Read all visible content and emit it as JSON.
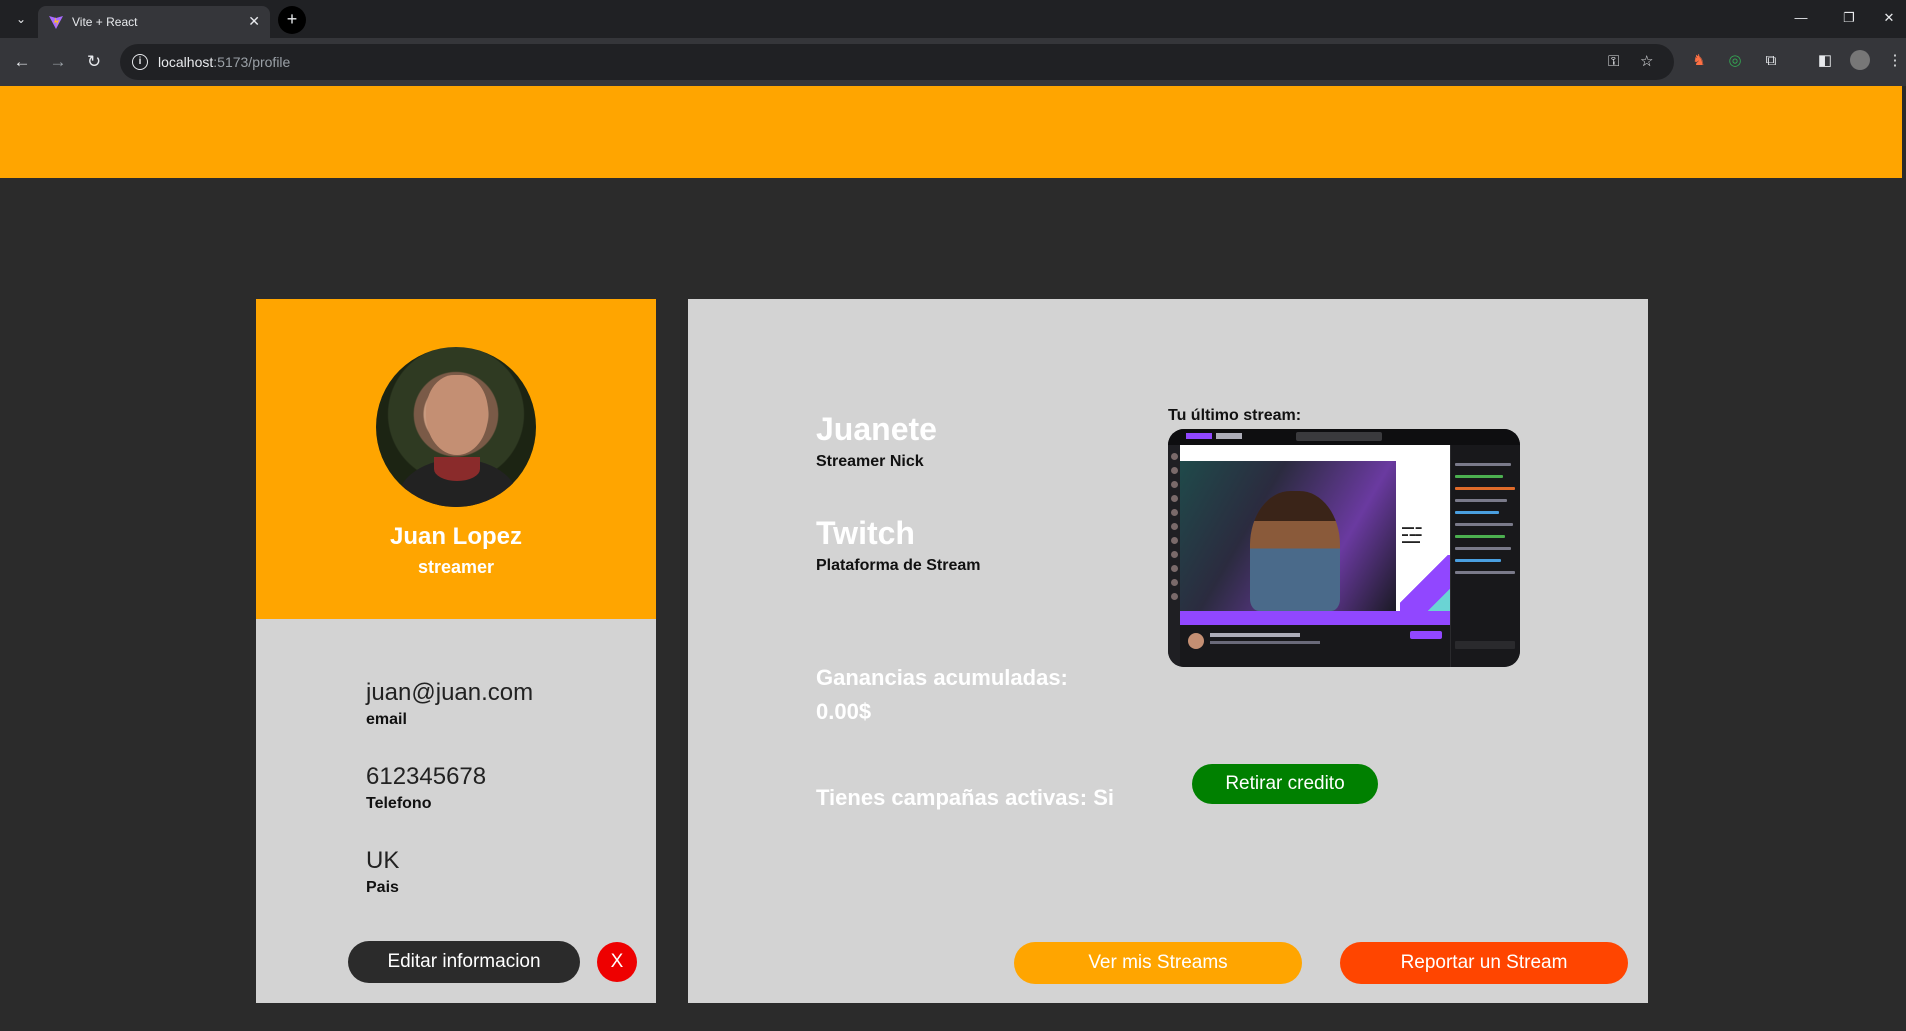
{
  "browser": {
    "tab_title": "Vite + React",
    "tab_close": "✕",
    "new_tab": "+",
    "url_host": "localhost",
    "url_rest": ":5173/profile"
  },
  "profile": {
    "name": "Juan Lopez",
    "role": "streamer",
    "email_value": "juan@juan.com",
    "email_label": "email",
    "phone_value": "612345678",
    "phone_label": "Telefono",
    "country_value": "UK",
    "country_label": "Pais",
    "edit_button": "Editar informacion",
    "close_button": "X"
  },
  "main": {
    "nick_value": "Juanete",
    "nick_label": "Streamer Nick",
    "platform_value": "Twitch",
    "platform_label": "Plataforma de Stream",
    "last_stream_label": "Tu último stream:",
    "earnings_label": "Ganancias acumuladas:",
    "earnings_value": "0.00$",
    "withdraw_button": "Retirar credito",
    "campaigns_text": "Tienes campañas activas: Si",
    "view_streams_button": "Ver mis Streams",
    "report_stream_button": "Reportar un Stream"
  },
  "colors": {
    "accent_orange": "#ffa500",
    "panel_gray": "#d3d3d3",
    "page_bg": "#2b2b2b",
    "withdraw_green": "#008000",
    "report_red": "#ff4500",
    "close_red": "#ee0000"
  }
}
